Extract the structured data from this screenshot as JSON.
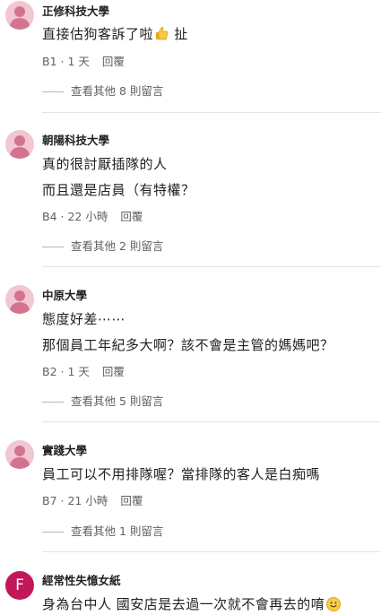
{
  "comments": [
    {
      "author": "正修科技大學",
      "lines": [
        "直接估狗客訴了啦",
        "扯"
      ],
      "floor": "B1",
      "time": "1 天",
      "reply_label": "回覆",
      "more_replies": "查看其他 8 則留言"
    },
    {
      "author": "朝陽科技大學",
      "lines": [
        "真的很討厭插隊的人",
        "而且還是店員（有特權？"
      ],
      "floor": "B4",
      "time": "22 小時",
      "reply_label": "回覆",
      "more_replies": "查看其他 2 則留言"
    },
    {
      "author": "中原大學",
      "lines": [
        "態度好差⋯⋯",
        "那個員工年紀多大啊？該不會是主管的媽媽吧？"
      ],
      "floor": "B2",
      "time": "1 天",
      "reply_label": "回覆",
      "more_replies": "查看其他 5 則留言"
    },
    {
      "author": "實踐大學",
      "lines": [
        "員工可以不用排隊喔？當排隊的客人是白痴嗎"
      ],
      "floor": "B7",
      "time": "21 小時",
      "reply_label": "回覆",
      "more_replies": "查看其他 1 則留言"
    },
    {
      "author": "經常性失憶女紙",
      "avatar_letter": "F",
      "lines": [
        "身為台中人 國安店是去過一次就不會再去的唷"
      ]
    }
  ],
  "meta_separator": " · ",
  "icons": {
    "avatar": "pink-person-avatar-icon",
    "thumbs_up": "thumbs-up-emoji-icon",
    "smile": "smile-emoji-icon"
  },
  "colors": {
    "avatar_bg": "#f2c6d3",
    "avatar_fg": "#d3738f",
    "letter_avatar_bg": "#c2185b",
    "meta_text": "#606060"
  }
}
